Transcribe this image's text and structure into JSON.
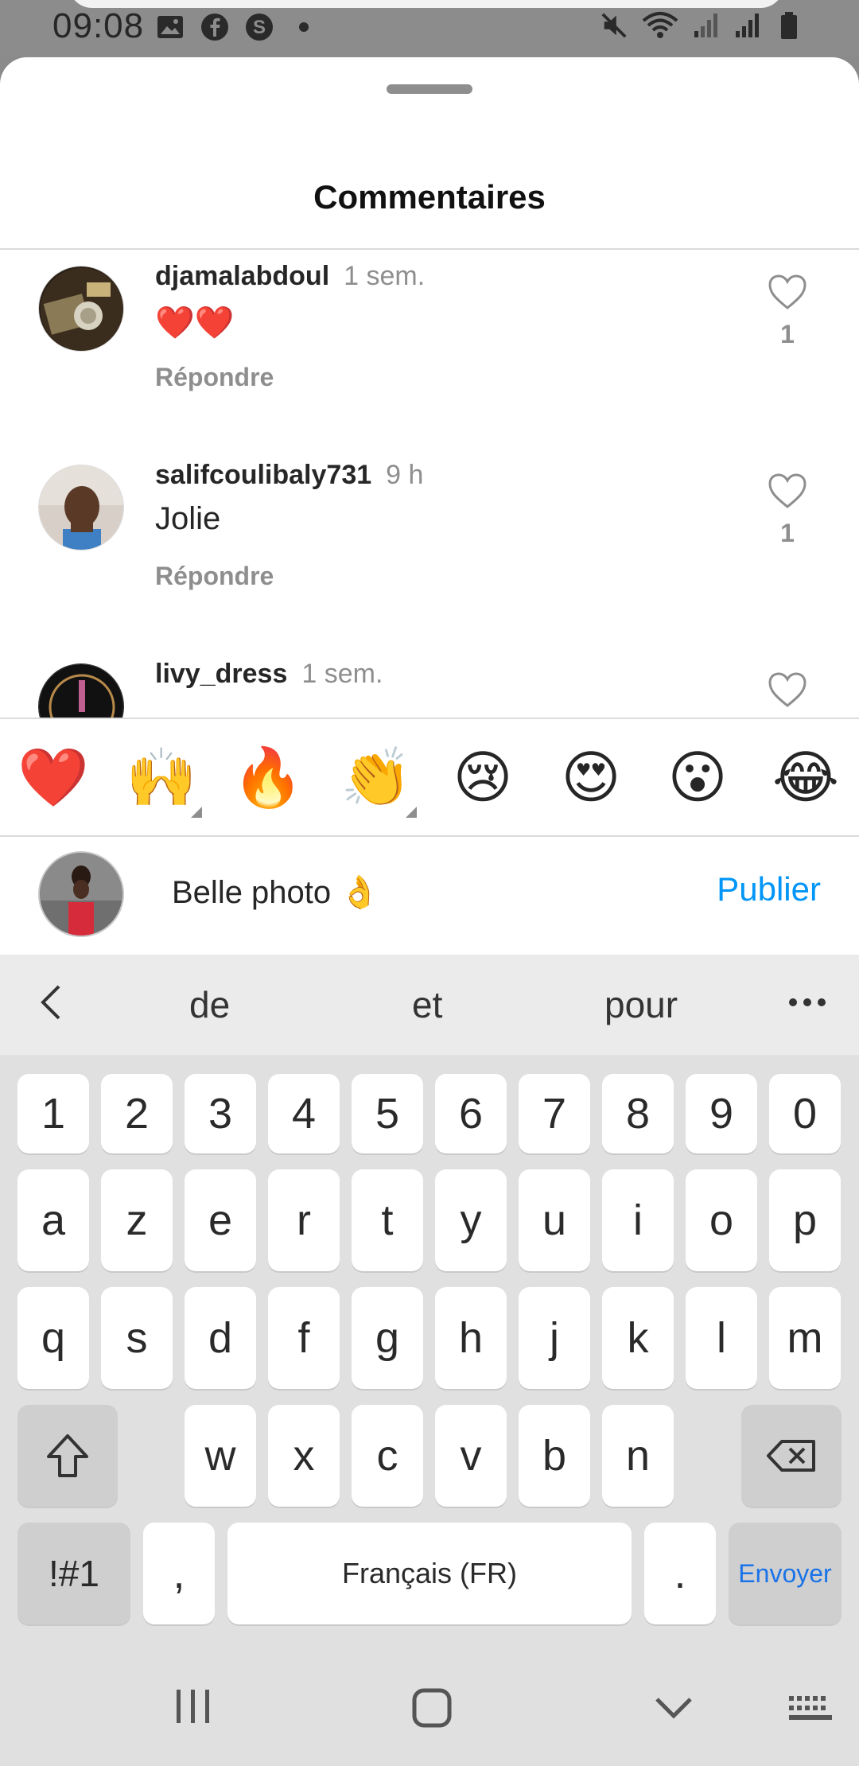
{
  "status_bar": {
    "time": "09:08",
    "icons_left": [
      "image-icon",
      "facebook-icon",
      "s-app-icon",
      "dot-icon"
    ],
    "icons_right": [
      "mute-icon",
      "wifi-icon",
      "signal-icon",
      "signal-icon",
      "battery-icon"
    ]
  },
  "sheet": {
    "title": "Commentaires"
  },
  "comments": [
    {
      "user": "djamalabdoul",
      "time": "1 sem.",
      "text": "❤️❤️",
      "reply": "Répondre",
      "likes": "1"
    },
    {
      "user": "salifcoulibaly731",
      "time": "9 h",
      "text": "Jolie",
      "reply": "Répondre",
      "likes": "1"
    },
    {
      "user": "livy_dress",
      "time": "1 sem.",
      "text": "",
      "reply": "",
      "likes": ""
    }
  ],
  "emoji_bar": [
    "❤️",
    "🙌",
    "🔥",
    "👏",
    "😢",
    "😍",
    "😮",
    "😂"
  ],
  "composer": {
    "text": "Belle photo 👌",
    "publish": "Publier"
  },
  "keyboard": {
    "suggestions": [
      "de",
      "et",
      "pour"
    ],
    "row_numbers": [
      "1",
      "2",
      "3",
      "4",
      "5",
      "6",
      "7",
      "8",
      "9",
      "0"
    ],
    "row1": [
      "a",
      "z",
      "e",
      "r",
      "t",
      "y",
      "u",
      "i",
      "o",
      "p"
    ],
    "row2": [
      "q",
      "s",
      "d",
      "f",
      "g",
      "h",
      "j",
      "k",
      "l",
      "m"
    ],
    "row3": [
      "w",
      "x",
      "c",
      "v",
      "b",
      "n"
    ],
    "symbols_key": "!#1",
    "comma_key": ",",
    "space_key": "Français (FR)",
    "period_key": ".",
    "send_key": "Envoyer"
  },
  "colors": {
    "accent": "#0095f6",
    "keyboard_bg": "#e0e0e0"
  }
}
